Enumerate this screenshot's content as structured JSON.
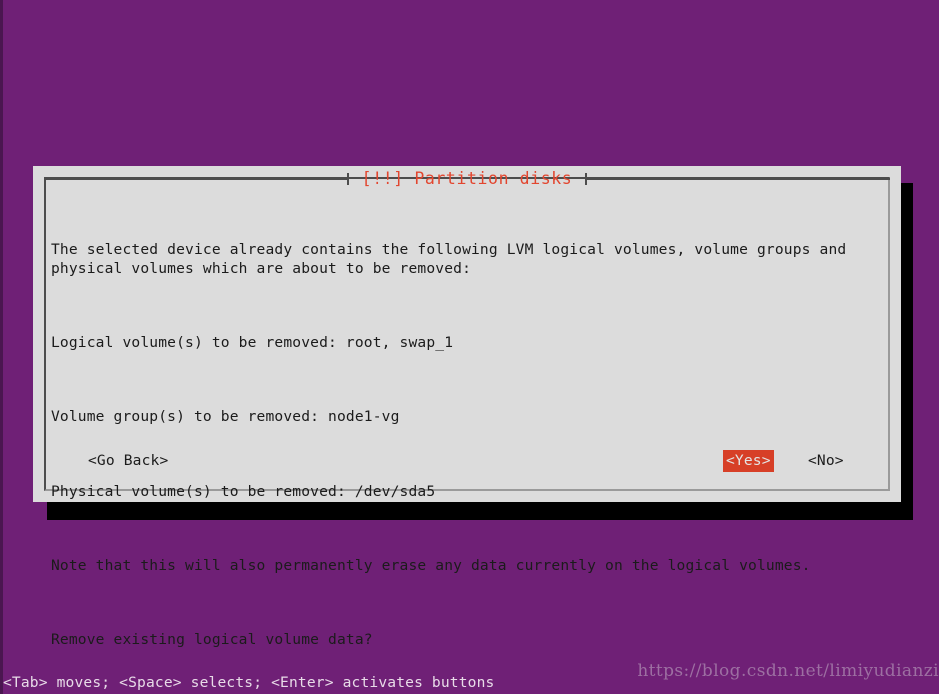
{
  "screen": {
    "background_color": "#6f2076",
    "text_color": "#e8dbe8"
  },
  "dialog": {
    "title": "[!!] Partition disks",
    "title_color": "#e2462f",
    "background_color": "#dcdcdc",
    "body": {
      "paragraphs": [
        "The selected device already contains the following LVM logical volumes, volume groups and\nphysical volumes which are about to be removed:",
        "Logical volume(s) to be removed: root, swap_1",
        "Volume group(s) to be removed: node1-vg",
        "Physical volume(s) to be removed: /dev/sda5",
        "Note that this will also permanently erase any data currently on the logical volumes.",
        "Remove existing logical volume data?"
      ]
    },
    "buttons": [
      {
        "label": "<Go Back>",
        "selected": false
      },
      {
        "label": "<Yes>",
        "selected": true
      },
      {
        "label": "<No>",
        "selected": false
      }
    ],
    "selected_button_bg": "#d73f27",
    "selected_button_fg": "#e4e4e4"
  },
  "helpbar": {
    "text": "<Tab> moves; <Space> selects; <Enter> activates buttons"
  },
  "watermark": {
    "text": "https://blog.csdn.net/limiyudianzi"
  }
}
